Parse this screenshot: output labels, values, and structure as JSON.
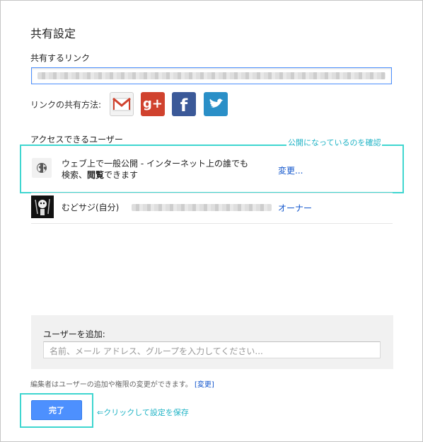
{
  "dialog": {
    "title": "共有設定",
    "share_link_label": "共有するリンク",
    "share_method_label": "リンクの共有方法:",
    "share_services": [
      "gmail-icon",
      "google-plus-icon",
      "facebook-icon",
      "twitter-icon"
    ],
    "gplus_glyph": "g+",
    "facebook_glyph": "f",
    "access_label": "アクセスできるユーザー",
    "public_row": {
      "line1": "ウェブ上で一般公開 - インターネット上の誰でも",
      "line2_prefix": "検索、",
      "line2_bold": "閲覧",
      "line2_suffix": "できます",
      "change_link": "変更..."
    },
    "owner_row": {
      "name": "むどサジ(自分)",
      "role": "オーナー"
    },
    "add_users": {
      "label": "ユーザーを追加:",
      "placeholder": "名前、メール アドレス、グループを入力してください..."
    },
    "note": {
      "text": "編集者はユーザーの追加や権限の変更ができます。",
      "link": "[変更]"
    },
    "done_button": "完了"
  },
  "annotations": {
    "public_check": "公開になっているのを確認",
    "click_save": "⇐クリックして設定を保存"
  },
  "colors": {
    "accent": "#4d90fe",
    "link": "#1155cc",
    "highlight": "#3fd6d0",
    "annotation_text": "#1fb3c5"
  }
}
